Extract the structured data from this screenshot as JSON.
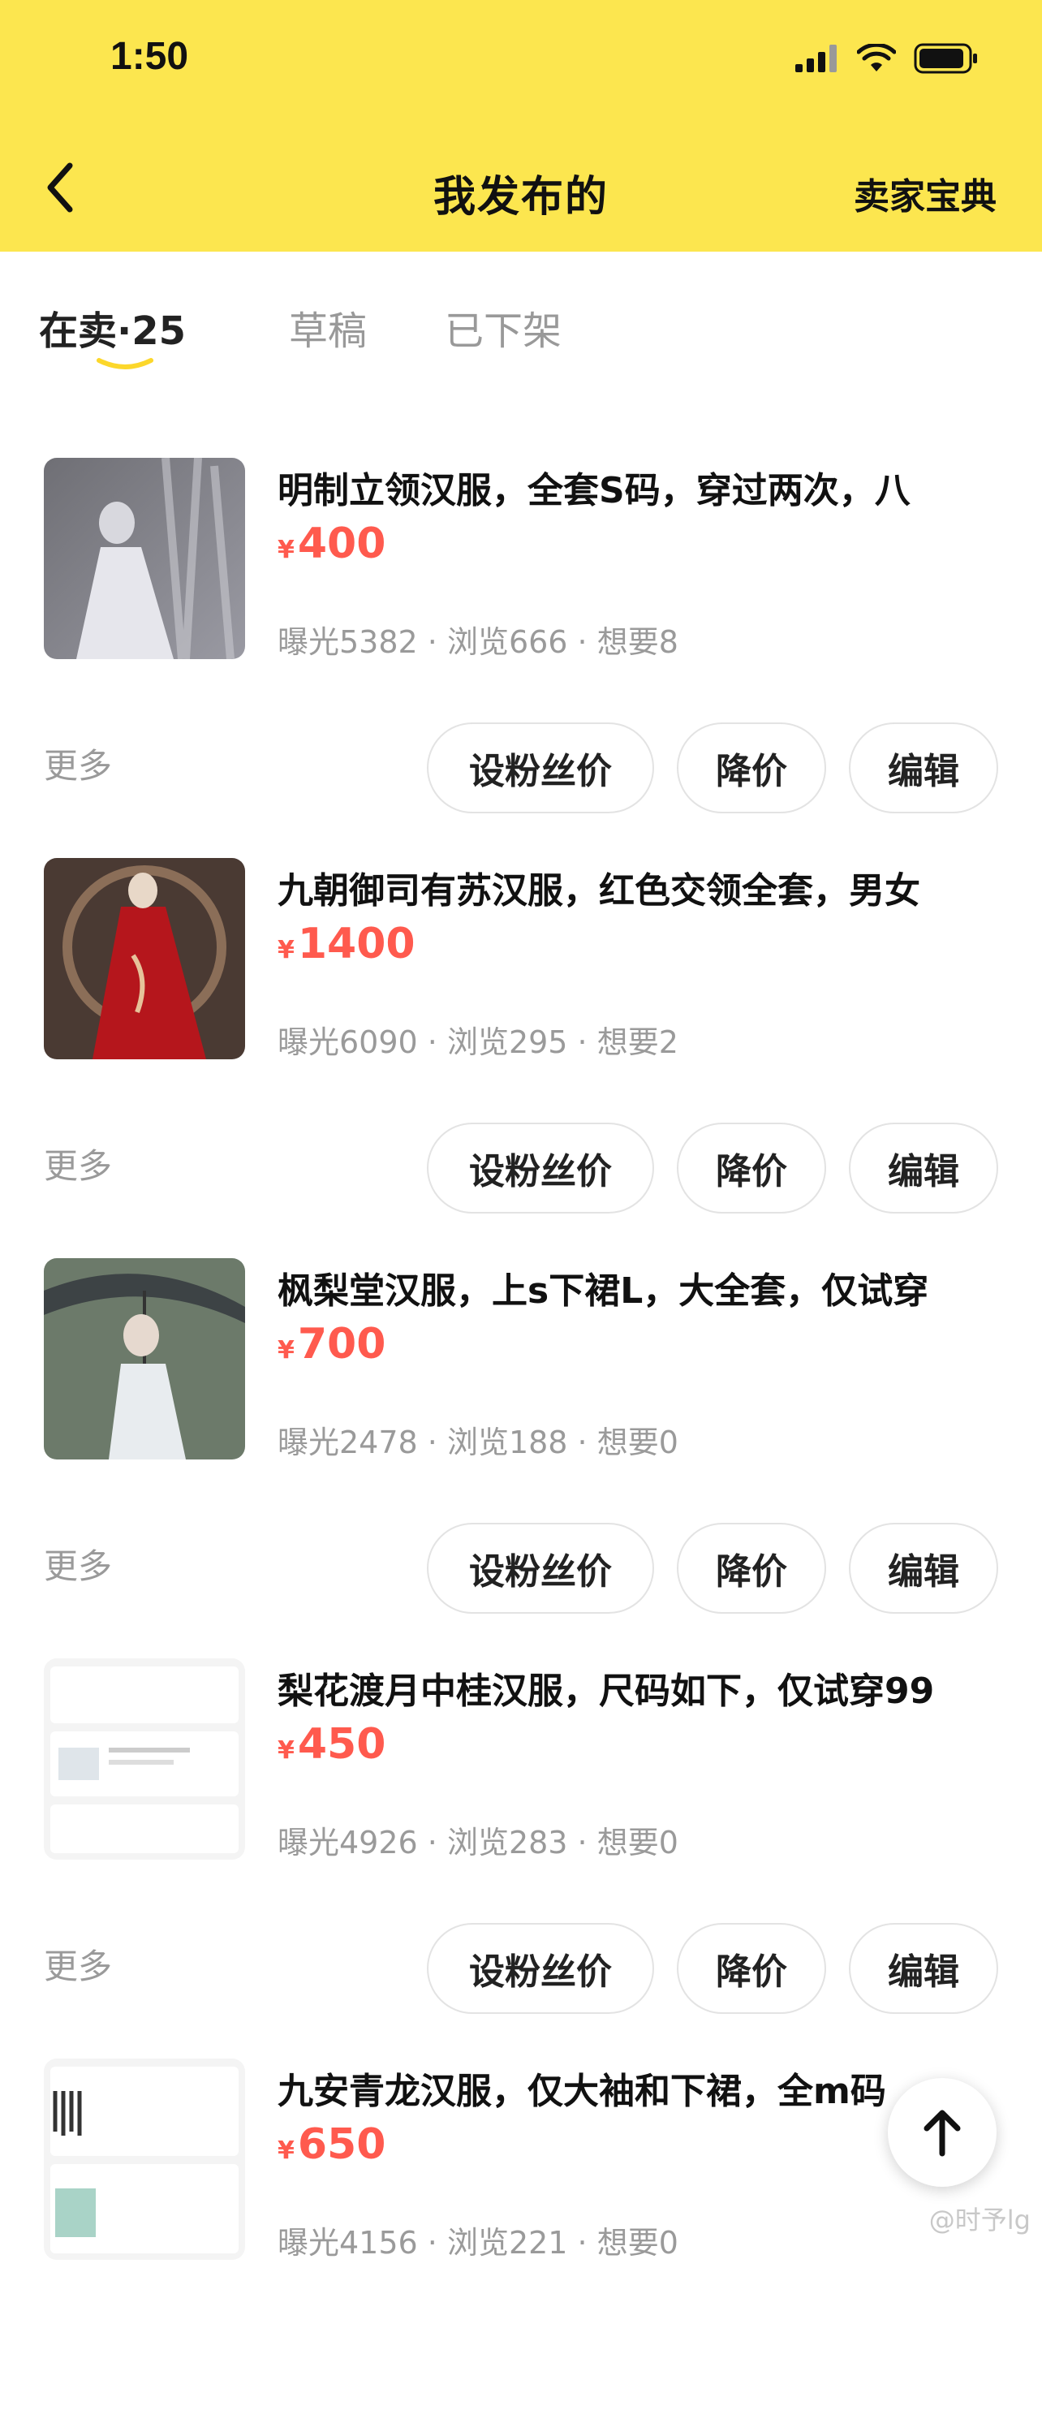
{
  "status": {
    "time": "1:50"
  },
  "nav": {
    "title": "我发布的",
    "right": "卖家宝典"
  },
  "tabs": {
    "selling": "在卖·25",
    "draft": "草稿",
    "removed": "已下架"
  },
  "currency": "¥",
  "buttons": {
    "fan_price": "设粉丝价",
    "drop_price": "降价",
    "edit": "编辑",
    "more": "更多"
  },
  "items": [
    {
      "title": "明制立领汉服，全套S码，穿过两次，八",
      "price": "400",
      "stats": "曝光5382 · 浏览666 · 想要8"
    },
    {
      "title": "九朝御司有苏汉服，红色交领全套，男女",
      "price": "1400",
      "stats": "曝光6090 · 浏览295 · 想要2"
    },
    {
      "title": "枫梨堂汉服，上s下裙L，大全套，仅试穿",
      "price": "700",
      "stats": "曝光2478 · 浏览188 · 想要0"
    },
    {
      "title": "梨花渡月中桂汉服，尺码如下，仅试穿99",
      "price": "450",
      "stats": "曝光4926 · 浏览283 · 想要0"
    },
    {
      "title": "九安青龙汉服，仅大袖和下裙，全m码",
      "price": "650",
      "stats": "曝光4156 · 浏览221 · 想要0"
    }
  ],
  "watermark": "@时予lg"
}
